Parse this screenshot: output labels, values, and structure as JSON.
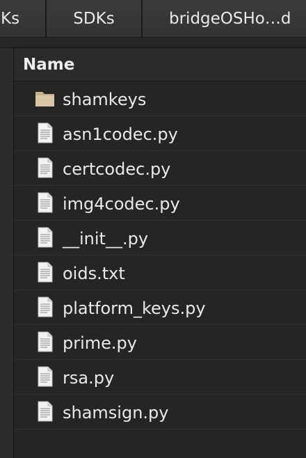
{
  "pathbar": {
    "crumbs": [
      "Ks",
      "SDKs",
      "bridgeOSHo…d"
    ]
  },
  "list": {
    "column_name": "Name",
    "items": [
      {
        "label": "shamkeys",
        "icon": "folder-icon"
      },
      {
        "label": "asn1codec.py",
        "icon": "text-file-icon"
      },
      {
        "label": "certcodec.py",
        "icon": "text-file-icon"
      },
      {
        "label": "img4codec.py",
        "icon": "text-file-icon"
      },
      {
        "label": "__init__.py",
        "icon": "text-file-icon"
      },
      {
        "label": "oids.txt",
        "icon": "text-file-icon"
      },
      {
        "label": "platform_keys.py",
        "icon": "text-file-icon"
      },
      {
        "label": "prime.py",
        "icon": "text-file-icon"
      },
      {
        "label": "rsa.py",
        "icon": "text-file-icon"
      },
      {
        "label": "shamsign.py",
        "icon": "text-file-icon"
      }
    ]
  }
}
